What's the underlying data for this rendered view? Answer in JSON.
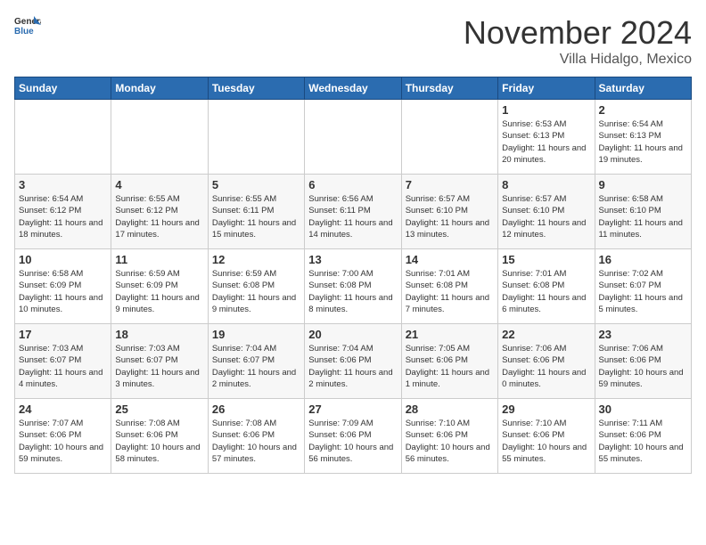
{
  "header": {
    "logo_general": "General",
    "logo_blue": "Blue",
    "month": "November 2024",
    "location": "Villa Hidalgo, Mexico"
  },
  "days_of_week": [
    "Sunday",
    "Monday",
    "Tuesday",
    "Wednesday",
    "Thursday",
    "Friday",
    "Saturday"
  ],
  "weeks": [
    [
      {
        "day": "",
        "info": ""
      },
      {
        "day": "",
        "info": ""
      },
      {
        "day": "",
        "info": ""
      },
      {
        "day": "",
        "info": ""
      },
      {
        "day": "",
        "info": ""
      },
      {
        "day": "1",
        "info": "Sunrise: 6:53 AM\nSunset: 6:13 PM\nDaylight: 11 hours and 20 minutes."
      },
      {
        "day": "2",
        "info": "Sunrise: 6:54 AM\nSunset: 6:13 PM\nDaylight: 11 hours and 19 minutes."
      }
    ],
    [
      {
        "day": "3",
        "info": "Sunrise: 6:54 AM\nSunset: 6:12 PM\nDaylight: 11 hours and 18 minutes."
      },
      {
        "day": "4",
        "info": "Sunrise: 6:55 AM\nSunset: 6:12 PM\nDaylight: 11 hours and 17 minutes."
      },
      {
        "day": "5",
        "info": "Sunrise: 6:55 AM\nSunset: 6:11 PM\nDaylight: 11 hours and 15 minutes."
      },
      {
        "day": "6",
        "info": "Sunrise: 6:56 AM\nSunset: 6:11 PM\nDaylight: 11 hours and 14 minutes."
      },
      {
        "day": "7",
        "info": "Sunrise: 6:57 AM\nSunset: 6:10 PM\nDaylight: 11 hours and 13 minutes."
      },
      {
        "day": "8",
        "info": "Sunrise: 6:57 AM\nSunset: 6:10 PM\nDaylight: 11 hours and 12 minutes."
      },
      {
        "day": "9",
        "info": "Sunrise: 6:58 AM\nSunset: 6:10 PM\nDaylight: 11 hours and 11 minutes."
      }
    ],
    [
      {
        "day": "10",
        "info": "Sunrise: 6:58 AM\nSunset: 6:09 PM\nDaylight: 11 hours and 10 minutes."
      },
      {
        "day": "11",
        "info": "Sunrise: 6:59 AM\nSunset: 6:09 PM\nDaylight: 11 hours and 9 minutes."
      },
      {
        "day": "12",
        "info": "Sunrise: 6:59 AM\nSunset: 6:08 PM\nDaylight: 11 hours and 9 minutes."
      },
      {
        "day": "13",
        "info": "Sunrise: 7:00 AM\nSunset: 6:08 PM\nDaylight: 11 hours and 8 minutes."
      },
      {
        "day": "14",
        "info": "Sunrise: 7:01 AM\nSunset: 6:08 PM\nDaylight: 11 hours and 7 minutes."
      },
      {
        "day": "15",
        "info": "Sunrise: 7:01 AM\nSunset: 6:08 PM\nDaylight: 11 hours and 6 minutes."
      },
      {
        "day": "16",
        "info": "Sunrise: 7:02 AM\nSunset: 6:07 PM\nDaylight: 11 hours and 5 minutes."
      }
    ],
    [
      {
        "day": "17",
        "info": "Sunrise: 7:03 AM\nSunset: 6:07 PM\nDaylight: 11 hours and 4 minutes."
      },
      {
        "day": "18",
        "info": "Sunrise: 7:03 AM\nSunset: 6:07 PM\nDaylight: 11 hours and 3 minutes."
      },
      {
        "day": "19",
        "info": "Sunrise: 7:04 AM\nSunset: 6:07 PM\nDaylight: 11 hours and 2 minutes."
      },
      {
        "day": "20",
        "info": "Sunrise: 7:04 AM\nSunset: 6:06 PM\nDaylight: 11 hours and 2 minutes."
      },
      {
        "day": "21",
        "info": "Sunrise: 7:05 AM\nSunset: 6:06 PM\nDaylight: 11 hours and 1 minute."
      },
      {
        "day": "22",
        "info": "Sunrise: 7:06 AM\nSunset: 6:06 PM\nDaylight: 11 hours and 0 minutes."
      },
      {
        "day": "23",
        "info": "Sunrise: 7:06 AM\nSunset: 6:06 PM\nDaylight: 10 hours and 59 minutes."
      }
    ],
    [
      {
        "day": "24",
        "info": "Sunrise: 7:07 AM\nSunset: 6:06 PM\nDaylight: 10 hours and 59 minutes."
      },
      {
        "day": "25",
        "info": "Sunrise: 7:08 AM\nSunset: 6:06 PM\nDaylight: 10 hours and 58 minutes."
      },
      {
        "day": "26",
        "info": "Sunrise: 7:08 AM\nSunset: 6:06 PM\nDaylight: 10 hours and 57 minutes."
      },
      {
        "day": "27",
        "info": "Sunrise: 7:09 AM\nSunset: 6:06 PM\nDaylight: 10 hours and 56 minutes."
      },
      {
        "day": "28",
        "info": "Sunrise: 7:10 AM\nSunset: 6:06 PM\nDaylight: 10 hours and 56 minutes."
      },
      {
        "day": "29",
        "info": "Sunrise: 7:10 AM\nSunset: 6:06 PM\nDaylight: 10 hours and 55 minutes."
      },
      {
        "day": "30",
        "info": "Sunrise: 7:11 AM\nSunset: 6:06 PM\nDaylight: 10 hours and 55 minutes."
      }
    ]
  ]
}
